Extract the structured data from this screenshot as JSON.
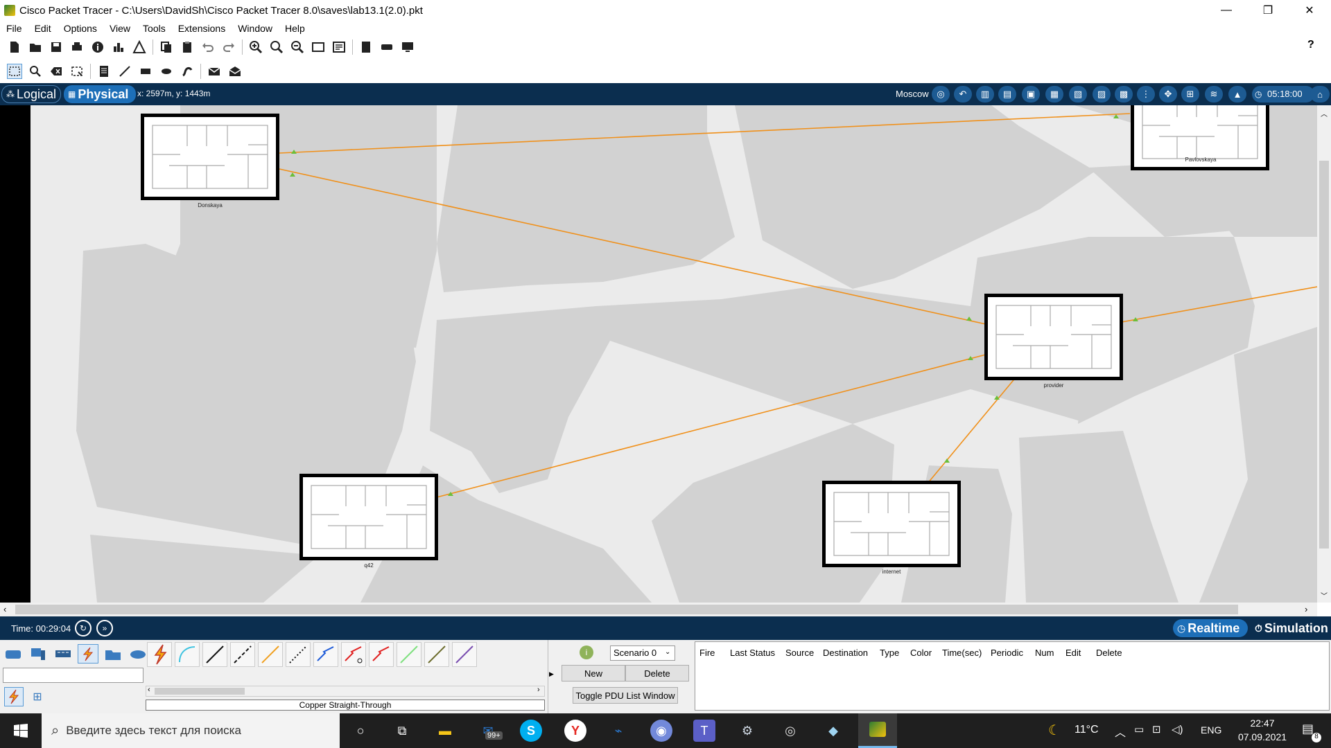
{
  "window": {
    "title": "Cisco Packet Tracer - C:\\Users\\DavidSh\\Cisco Packet Tracer 8.0\\saves\\lab13.1(2.0).pkt",
    "minimize": "—",
    "maximize": "❐",
    "close": "✕"
  },
  "menu": [
    "File",
    "Edit",
    "Options",
    "View",
    "Tools",
    "Extensions",
    "Window",
    "Help"
  ],
  "help_icon": "?",
  "navbar": {
    "logical": "Logical",
    "physical": "Physical",
    "coords": "x: 2597m, y: 1443m",
    "location": "Moscow",
    "clock": "05:18:00"
  },
  "buildings": [
    {
      "name": "Donskaya"
    },
    {
      "name": "Pavlovskaya"
    },
    {
      "name": "provider"
    },
    {
      "name": "q42"
    },
    {
      "name": "internet"
    }
  ],
  "timebar": {
    "time": "Time: 00:29:04",
    "realtime": "Realtime",
    "simulation": "Simulation"
  },
  "bottom": {
    "cable_label": "Copper Straight-Through",
    "scenario": "Scenario 0",
    "new": "New",
    "delete": "Delete",
    "toggle": "Toggle PDU List Window",
    "pdu_columns": [
      "Fire",
      "Last Status",
      "Source",
      "Destination",
      "Type",
      "Color",
      "Time(sec)",
      "Periodic",
      "Num",
      "Edit",
      "Delete"
    ]
  },
  "taskbar": {
    "search_placeholder": "Введите здесь текст для поиска",
    "weather": "11°C",
    "lang": "ENG",
    "time": "22:47",
    "date": "07.09.2021",
    "mail_badge": "99+",
    "notif_badge": "8"
  },
  "colors": {
    "link": "#f0901a",
    "nav_bg": "#0b2e4f",
    "nav_active": "#1d6fb8"
  }
}
